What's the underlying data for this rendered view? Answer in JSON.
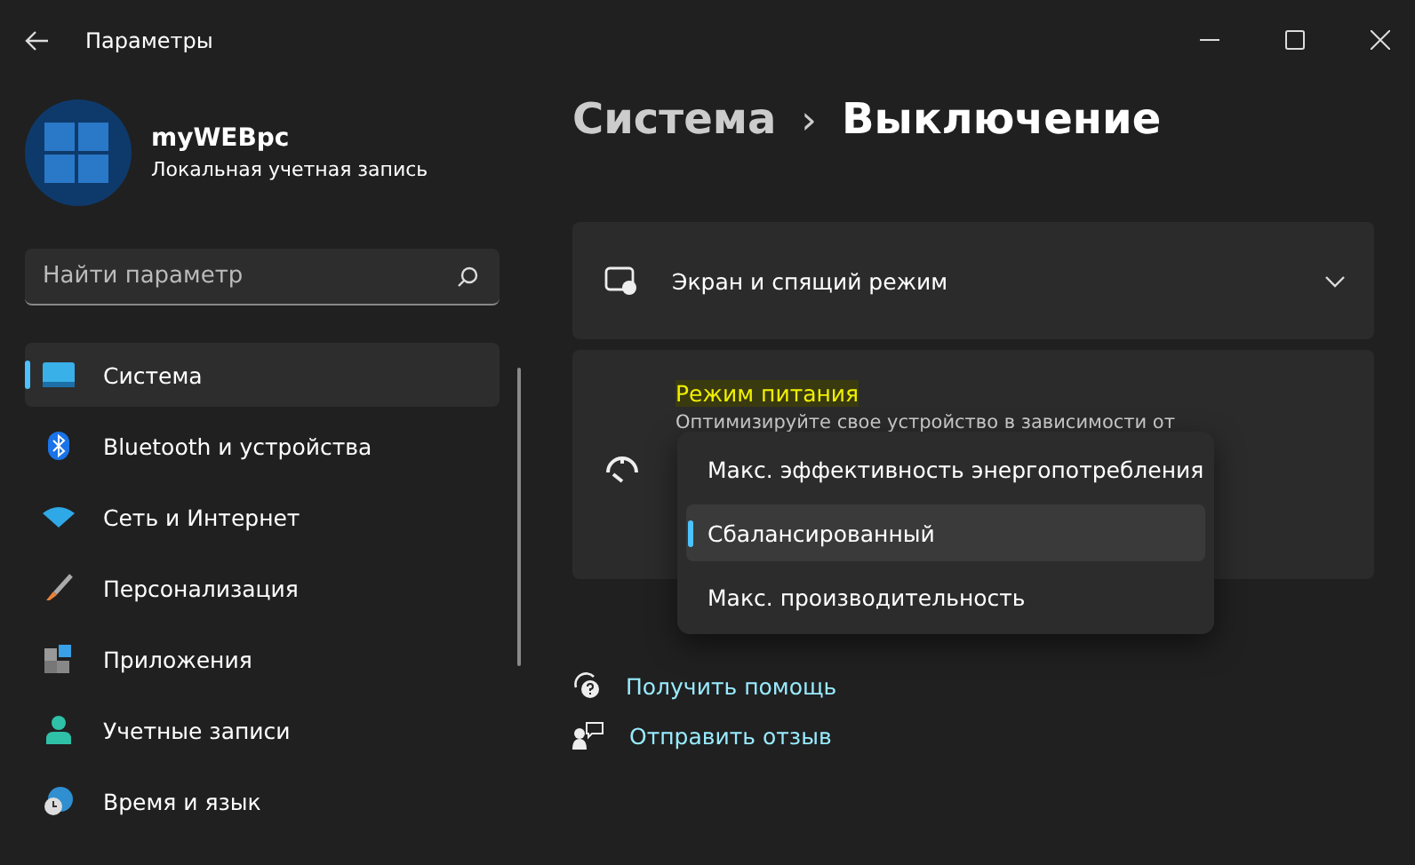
{
  "window": {
    "title": "Параметры"
  },
  "account": {
    "name": "myWEBpc",
    "type": "Локальная учетная запись"
  },
  "search": {
    "placeholder": "Найти параметр"
  },
  "nav": [
    {
      "label": "Система",
      "kind": "system",
      "selected": true
    },
    {
      "label": "Bluetooth и устройства",
      "kind": "bluetooth",
      "selected": false
    },
    {
      "label": "Сеть и Интернет",
      "kind": "wifi",
      "selected": false
    },
    {
      "label": "Персонализация",
      "kind": "brush",
      "selected": false
    },
    {
      "label": "Приложения",
      "kind": "apps",
      "selected": false
    },
    {
      "label": "Учетные записи",
      "kind": "person",
      "selected": false
    },
    {
      "label": "Время и язык",
      "kind": "clock",
      "selected": false
    }
  ],
  "breadcrumb": {
    "parent": "Система",
    "separator": "›",
    "current": "Выключение"
  },
  "cards": [
    {
      "kind": "expander",
      "title": "Экран и спящий режим",
      "expanded": false
    },
    {
      "kind": "power",
      "title": "Режим питания",
      "description": "Оптимизируйте свое устройство в зависимости от"
    }
  ],
  "power_menu": [
    {
      "label": "Макс. эффективность энергопотребления",
      "selected": false
    },
    {
      "label": "Сбалансированный",
      "selected": true
    },
    {
      "label": "Макс. производительность",
      "selected": false
    }
  ],
  "links": [
    {
      "label": "Получить помощь",
      "kind": "help"
    },
    {
      "label": "Отправить отзыв",
      "kind": "feedback"
    }
  ]
}
